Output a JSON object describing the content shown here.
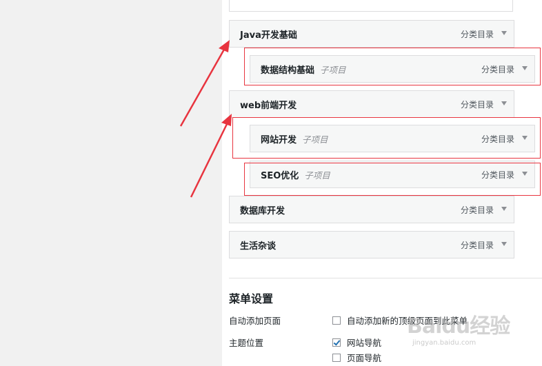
{
  "menu_items": [
    {
      "title": "Java开发基础",
      "subtitle": "",
      "type": "分类目录"
    },
    {
      "title": "数据结构基础",
      "subtitle": "子项目",
      "type": "分类目录"
    },
    {
      "title": "web前端开发",
      "subtitle": "",
      "type": "分类目录"
    },
    {
      "title": "网站开发",
      "subtitle": "子项目",
      "type": "分类目录"
    },
    {
      "title": "SEO优化",
      "subtitle": "子项目",
      "type": "分类目录"
    },
    {
      "title": "数据库开发",
      "subtitle": "",
      "type": "分类目录"
    },
    {
      "title": "生活杂谈",
      "subtitle": "",
      "type": "分类目录"
    }
  ],
  "settings": {
    "title": "菜单设置",
    "auto_add_label": "自动添加页面",
    "auto_add_option": "自动添加新的顶级页面到此菜单",
    "auto_add_checked": false,
    "theme_location_label": "主题位置",
    "locations": [
      {
        "label": "网站导航",
        "checked": true
      },
      {
        "label": "页面导航",
        "checked": false
      }
    ]
  },
  "colors": {
    "annotation_red": "#e8343f",
    "link_blue": "#2271b1",
    "item_bg": "#f6f7f7",
    "item_border": "#dcdcde"
  },
  "watermark": {
    "logo": "Baidu经验",
    "url": "jingyan.baidu.com"
  }
}
